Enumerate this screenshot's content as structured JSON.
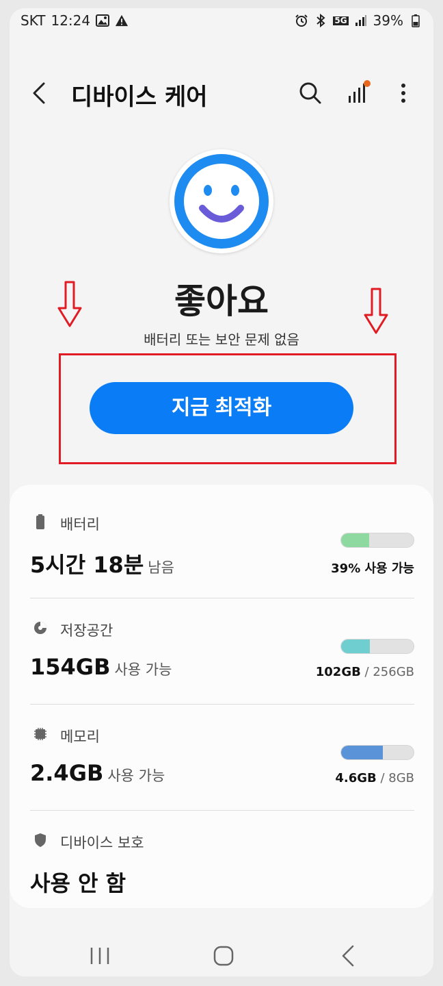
{
  "status_bar": {
    "carrier": "SKT",
    "time": "12:24",
    "network": "5G",
    "battery_percent": "39%"
  },
  "header": {
    "title": "디바이스 케어"
  },
  "status": {
    "heading": "좋아요",
    "subtitle": "배터리 또는 보안 문제 없음"
  },
  "optimize_button": {
    "label": "지금 최적화"
  },
  "items": {
    "battery": {
      "label": "배터리",
      "value": "5시간 18분",
      "unit": "남음",
      "detail": "39% 사용 가능",
      "level": 0.39,
      "color": "#8ed99f"
    },
    "storage": {
      "label": "저장공간",
      "value": "154GB",
      "unit": "사용 가능",
      "used": "102GB",
      "total": " / 256GB",
      "level": 0.4,
      "color": "#6fcfd0"
    },
    "memory": {
      "label": "메모리",
      "value": "2.4GB",
      "unit": "사용 가능",
      "used": "4.6GB",
      "total": " / 8GB",
      "level": 0.575,
      "color": "#5b93d8"
    },
    "protection": {
      "label": "디바이스 보호",
      "value": "사용 안 함"
    }
  },
  "colors": {
    "accent": "#0a7cf5",
    "highlight": "#e01b24",
    "face_ring": "#1e8bf0",
    "smile": "#6a5bd9"
  }
}
